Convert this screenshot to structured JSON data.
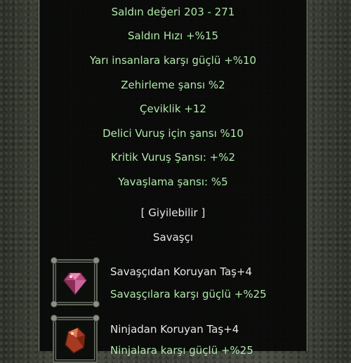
{
  "stats": [
    "Saldın değeri 203 - 271",
    "Saldın Hızı +%15",
    "Yarı insanlara karşı güçlü +%10",
    "Zehirleme şansı %2",
    "Çeviklik +12",
    "Delici Vuruş için şansı %10",
    "Kritik Vuruş Şansı: +%2",
    "Yavaşlama şansı: %5"
  ],
  "wearable": "[ Giyilebilir ]",
  "class_name": "Savaşçı",
  "sockets": [
    {
      "icon": "pink-gem-icon",
      "name": "Savaşçıdan Koruyan Taş+4",
      "effect": "Savaşçılara karşı güçlü +%25"
    },
    {
      "icon": "red-gem-icon",
      "name": "Ninjadan Koruyan Taş+4",
      "effect": "Ninjalara karşı güçlü +%25"
    }
  ],
  "colors": {
    "stat_green": "#b0e8aa",
    "label_white": "#e6e6e6"
  }
}
